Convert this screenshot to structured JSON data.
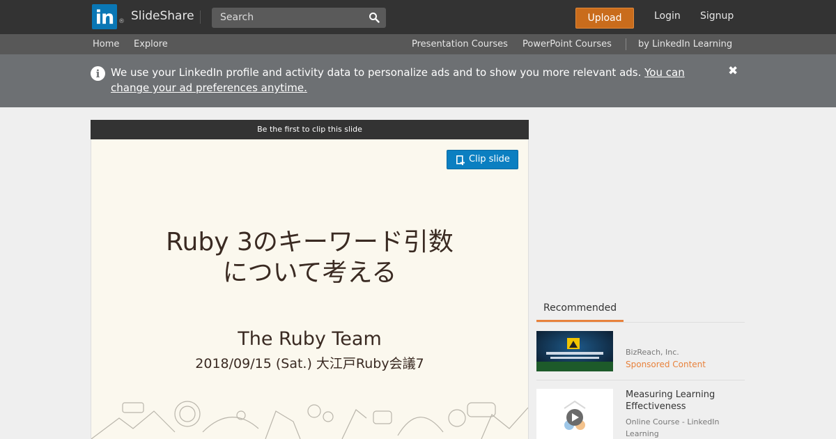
{
  "header": {
    "logo_letters": "in",
    "logo_reg": "®",
    "brand": "SlideShare",
    "search_placeholder": "Search",
    "upload_label": "Upload",
    "login_label": "Login",
    "signup_label": "Signup"
  },
  "subnav": {
    "home": "Home",
    "explore": "Explore",
    "presentation_courses": "Presentation Courses",
    "powerpoint_courses": "PowerPoint Courses",
    "by_linkedin": "by LinkedIn Learning"
  },
  "notice": {
    "text": "We use your LinkedIn profile and activity data to personalize ads and to show you more relevant ads. ",
    "link": "You can change your ad preferences anytime.",
    "close": "✖"
  },
  "player": {
    "clip_bar": "Be the first to clip this slide",
    "clip_button": "Clip slide",
    "slide_title_line1": "Ruby 3のキーワード引数",
    "slide_title_line2": "について考える",
    "slide_author": "The Ruby Team",
    "slide_date": "2018/09/15 (Sat.)  大江戸Ruby会議7"
  },
  "recommended": {
    "tab_label": "Recommended",
    "items": [
      {
        "company": "BizReach, Inc.",
        "sponsored": "Sponsored Content"
      },
      {
        "title": "Measuring Learning Effectiveness",
        "meta": "Online Course - LinkedIn Learning"
      }
    ]
  },
  "colors": {
    "topbar": "#333333",
    "subnav": "#585858",
    "notice": "#6d7073",
    "upload": "#c96c1c",
    "clip": "#0b7fc1",
    "accent": "#e8823c"
  },
  "icons": [
    "search-icon",
    "info-icon",
    "close-icon",
    "clip-icon",
    "play-icon"
  ]
}
